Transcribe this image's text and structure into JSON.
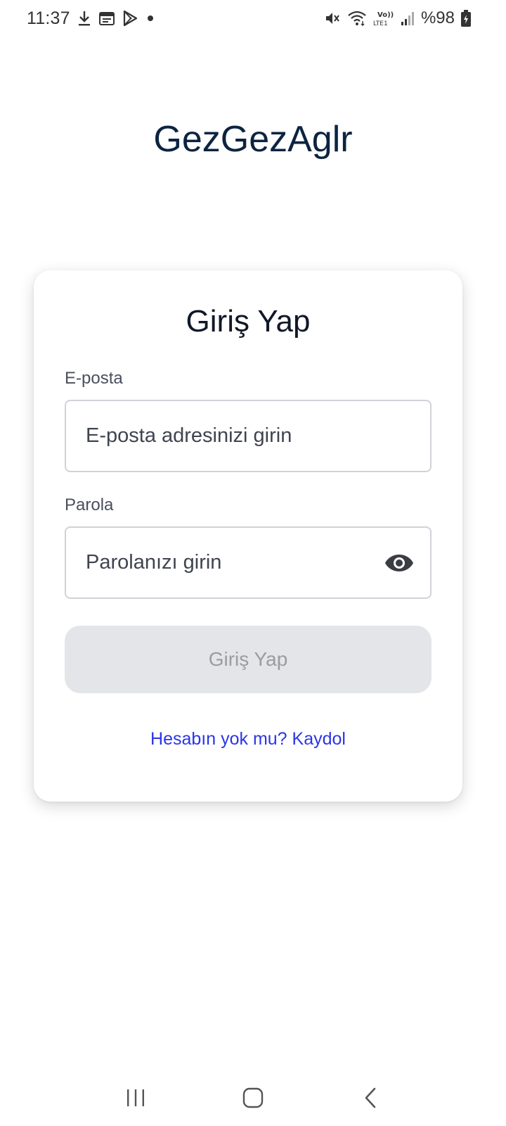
{
  "status_bar": {
    "time": "11:37",
    "battery": "%98",
    "icons": [
      "download-icon",
      "calendar-icon",
      "play-store-icon",
      "notification-dot-icon",
      "mute-icon",
      "wifi-icon",
      "volte-icon",
      "signal-icon",
      "battery-icon"
    ]
  },
  "app": {
    "title": "GezGezAglr"
  },
  "login_card": {
    "title": "Giriş Yap",
    "email_label": "E-posta",
    "email_placeholder": "E-posta adresinizi girin",
    "email_value": "",
    "password_label": "Parola",
    "password_placeholder": "Parolanızı girin",
    "password_value": "",
    "submit_label": "Giriş Yap",
    "signup_link": "Hesabın yok mu? Kaydol"
  },
  "colors": {
    "title": "#0d2440",
    "link": "#2b35e6",
    "button_disabled_bg": "#e4e5e8",
    "button_disabled_text": "#9a9ca3"
  }
}
